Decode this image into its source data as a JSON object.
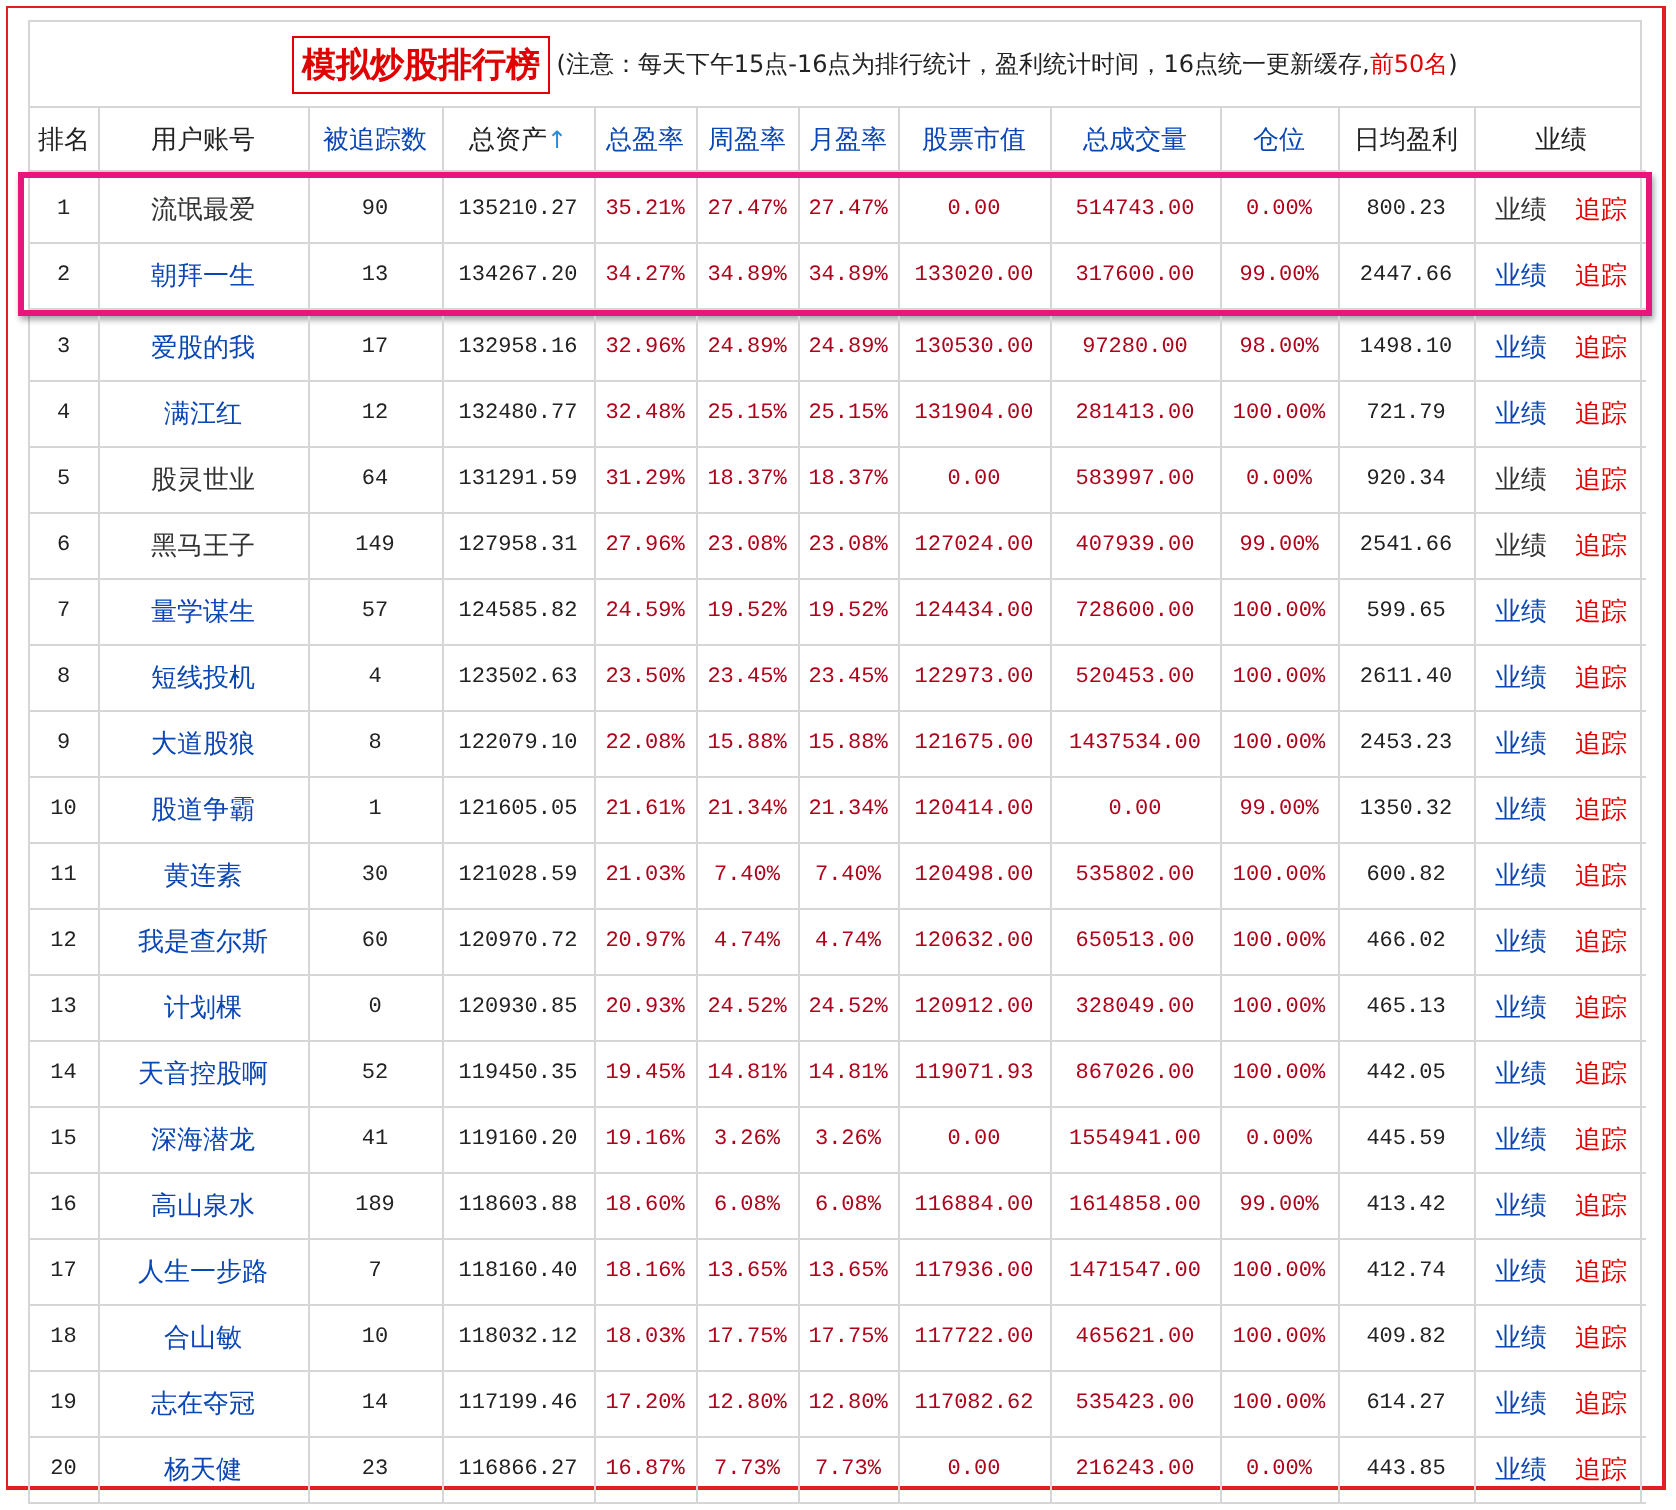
{
  "title": "模拟炒股排行榜",
  "note": {
    "prefix": "(注意：每天下午15点-16点为排行统计，盈利统计时间，16点统一更新缓存,",
    "highlight": "前50名",
    "suffix": ")"
  },
  "columns": [
    {
      "label": "排名",
      "kind": "plain",
      "linked": false
    },
    {
      "label": "用户账号",
      "kind": "account",
      "linked": false
    },
    {
      "label": "被追踪数",
      "kind": "plain",
      "linked": true
    },
    {
      "label": "总资产",
      "kind": "plain",
      "linked": false,
      "sort_arrow": "↑"
    },
    {
      "label": "总盈率",
      "kind": "red",
      "linked": true
    },
    {
      "label": "周盈率",
      "kind": "red",
      "linked": true
    },
    {
      "label": "月盈率",
      "kind": "red",
      "linked": true
    },
    {
      "label": "股票市值",
      "kind": "red",
      "linked": true
    },
    {
      "label": "总成交量",
      "kind": "red",
      "linked": true
    },
    {
      "label": "仓位",
      "kind": "red",
      "linked": true
    },
    {
      "label": "日均盈利",
      "kind": "plain",
      "linked": false
    },
    {
      "label": "业绩",
      "kind": "actions",
      "linked": false
    }
  ],
  "rows": [
    {
      "cells": [
        "1",
        "流氓最爱",
        "90",
        "135210.27",
        "35.21%",
        "27.47%",
        "27.47%",
        "0.00",
        "514743.00",
        "0.00%",
        "800.23"
      ],
      "linked": false,
      "highlighted": true,
      "actions": [
        {
          "label": "业绩",
          "kind": "record"
        },
        {
          "label": "追踪",
          "kind": "follow"
        }
      ]
    },
    {
      "cells": [
        "2",
        "朝拜一生",
        "13",
        "134267.20",
        "34.27%",
        "34.89%",
        "34.89%",
        "133020.00",
        "317600.00",
        "99.00%",
        "2447.66"
      ],
      "linked": true,
      "highlighted": true,
      "actions": [
        {
          "label": "业绩",
          "kind": "record"
        },
        {
          "label": "追踪",
          "kind": "follow"
        }
      ]
    },
    {
      "cells": [
        "3",
        "爱股的我",
        "17",
        "132958.16",
        "32.96%",
        "24.89%",
        "24.89%",
        "130530.00",
        "97280.00",
        "98.00%",
        "1498.10"
      ],
      "linked": true,
      "highlighted": false,
      "actions": [
        {
          "label": "业绩",
          "kind": "record"
        },
        {
          "label": "追踪",
          "kind": "follow"
        }
      ]
    },
    {
      "cells": [
        "4",
        "满江红",
        "12",
        "132480.77",
        "32.48%",
        "25.15%",
        "25.15%",
        "131904.00",
        "281413.00",
        "100.00%",
        "721.79"
      ],
      "linked": true,
      "highlighted": false,
      "actions": [
        {
          "label": "业绩",
          "kind": "record"
        },
        {
          "label": "追踪",
          "kind": "follow"
        }
      ]
    },
    {
      "cells": [
        "5",
        "股灵世业",
        "64",
        "131291.59",
        "31.29%",
        "18.37%",
        "18.37%",
        "0.00",
        "583997.00",
        "0.00%",
        "920.34"
      ],
      "linked": false,
      "highlighted": false,
      "actions": [
        {
          "label": "业绩",
          "kind": "record"
        },
        {
          "label": "追踪",
          "kind": "follow"
        }
      ]
    },
    {
      "cells": [
        "6",
        "黑马王子",
        "149",
        "127958.31",
        "27.96%",
        "23.08%",
        "23.08%",
        "127024.00",
        "407939.00",
        "99.00%",
        "2541.66"
      ],
      "linked": false,
      "highlighted": false,
      "actions": [
        {
          "label": "业绩",
          "kind": "record"
        },
        {
          "label": "追踪",
          "kind": "follow"
        }
      ]
    },
    {
      "cells": [
        "7",
        "量学谋生",
        "57",
        "124585.82",
        "24.59%",
        "19.52%",
        "19.52%",
        "124434.00",
        "728600.00",
        "100.00%",
        "599.65"
      ],
      "linked": true,
      "highlighted": false,
      "actions": [
        {
          "label": "业绩",
          "kind": "record"
        },
        {
          "label": "追踪",
          "kind": "follow"
        }
      ]
    },
    {
      "cells": [
        "8",
        "短线投机",
        "4",
        "123502.63",
        "23.50%",
        "23.45%",
        "23.45%",
        "122973.00",
        "520453.00",
        "100.00%",
        "2611.40"
      ],
      "linked": true,
      "highlighted": false,
      "actions": [
        {
          "label": "业绩",
          "kind": "record"
        },
        {
          "label": "追踪",
          "kind": "follow"
        }
      ]
    },
    {
      "cells": [
        "9",
        "大道股狼",
        "8",
        "122079.10",
        "22.08%",
        "15.88%",
        "15.88%",
        "121675.00",
        "1437534.00",
        "100.00%",
        "2453.23"
      ],
      "linked": true,
      "highlighted": false,
      "actions": [
        {
          "label": "业绩",
          "kind": "record"
        },
        {
          "label": "追踪",
          "kind": "follow"
        }
      ]
    },
    {
      "cells": [
        "10",
        "股道争霸",
        "1",
        "121605.05",
        "21.61%",
        "21.34%",
        "21.34%",
        "120414.00",
        "0.00",
        "99.00%",
        "1350.32"
      ],
      "linked": true,
      "highlighted": false,
      "actions": [
        {
          "label": "业绩",
          "kind": "record"
        },
        {
          "label": "追踪",
          "kind": "follow"
        }
      ]
    },
    {
      "cells": [
        "11",
        "黄连素",
        "30",
        "121028.59",
        "21.03%",
        "7.40%",
        "7.40%",
        "120498.00",
        "535802.00",
        "100.00%",
        "600.82"
      ],
      "linked": true,
      "highlighted": false,
      "actions": [
        {
          "label": "业绩",
          "kind": "record"
        },
        {
          "label": "追踪",
          "kind": "follow"
        }
      ]
    },
    {
      "cells": [
        "12",
        "我是查尔斯",
        "60",
        "120970.72",
        "20.97%",
        "4.74%",
        "4.74%",
        "120632.00",
        "650513.00",
        "100.00%",
        "466.02"
      ],
      "linked": true,
      "highlighted": false,
      "actions": [
        {
          "label": "业绩",
          "kind": "record"
        },
        {
          "label": "追踪",
          "kind": "follow"
        }
      ]
    },
    {
      "cells": [
        "13",
        "计划棵",
        "0",
        "120930.85",
        "20.93%",
        "24.52%",
        "24.52%",
        "120912.00",
        "328049.00",
        "100.00%",
        "465.13"
      ],
      "linked": true,
      "highlighted": false,
      "actions": [
        {
          "label": "业绩",
          "kind": "record"
        },
        {
          "label": "追踪",
          "kind": "follow"
        }
      ]
    },
    {
      "cells": [
        "14",
        "天音控股啊",
        "52",
        "119450.35",
        "19.45%",
        "14.81%",
        "14.81%",
        "119071.93",
        "867026.00",
        "100.00%",
        "442.05"
      ],
      "linked": true,
      "highlighted": false,
      "actions": [
        {
          "label": "业绩",
          "kind": "record"
        },
        {
          "label": "追踪",
          "kind": "follow"
        }
      ]
    },
    {
      "cells": [
        "15",
        "深海潜龙",
        "41",
        "119160.20",
        "19.16%",
        "3.26%",
        "3.26%",
        "0.00",
        "1554941.00",
        "0.00%",
        "445.59"
      ],
      "linked": true,
      "highlighted": false,
      "actions": [
        {
          "label": "业绩",
          "kind": "record"
        },
        {
          "label": "追踪",
          "kind": "follow"
        }
      ]
    },
    {
      "cells": [
        "16",
        "高山泉水",
        "189",
        "118603.88",
        "18.60%",
        "6.08%",
        "6.08%",
        "116884.00",
        "1614858.00",
        "99.00%",
        "413.42"
      ],
      "linked": true,
      "highlighted": false,
      "actions": [
        {
          "label": "业绩",
          "kind": "record"
        },
        {
          "label": "追踪",
          "kind": "follow"
        }
      ]
    },
    {
      "cells": [
        "17",
        "人生一步路",
        "7",
        "118160.40",
        "18.16%",
        "13.65%",
        "13.65%",
        "117936.00",
        "1471547.00",
        "100.00%",
        "412.74"
      ],
      "linked": true,
      "highlighted": false,
      "actions": [
        {
          "label": "业绩",
          "kind": "record"
        },
        {
          "label": "追踪",
          "kind": "follow"
        }
      ]
    },
    {
      "cells": [
        "18",
        "合山敏",
        "10",
        "118032.12",
        "18.03%",
        "17.75%",
        "17.75%",
        "117722.00",
        "465621.00",
        "100.00%",
        "409.82"
      ],
      "linked": true,
      "highlighted": false,
      "actions": [
        {
          "label": "业绩",
          "kind": "record"
        },
        {
          "label": "追踪",
          "kind": "follow"
        }
      ]
    },
    {
      "cells": [
        "19",
        "志在夺冠",
        "14",
        "117199.46",
        "17.20%",
        "12.80%",
        "12.80%",
        "117082.62",
        "535423.00",
        "100.00%",
        "614.27"
      ],
      "linked": true,
      "highlighted": false,
      "actions": [
        {
          "label": "业绩",
          "kind": "record"
        },
        {
          "label": "追踪",
          "kind": "follow"
        }
      ]
    },
    {
      "cells": [
        "20",
        "杨天健",
        "23",
        "116866.27",
        "16.87%",
        "7.73%",
        "7.73%",
        "0.00",
        "216243.00",
        "0.00%",
        "443.85"
      ],
      "linked": true,
      "highlighted": false,
      "actions": [
        {
          "label": "业绩",
          "kind": "record"
        },
        {
          "label": "追踪",
          "kind": "follow"
        }
      ]
    }
  ]
}
